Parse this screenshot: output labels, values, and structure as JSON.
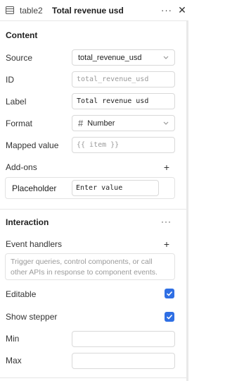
{
  "header": {
    "component_name": "table2",
    "column_title": "Total revenue usd",
    "more_icon": "more-horizontal-icon",
    "close_icon": "close-icon",
    "table_icon": "table-icon"
  },
  "content": {
    "title": "Content",
    "source": {
      "label": "Source",
      "value": "total_revenue_usd"
    },
    "id": {
      "label": "ID",
      "placeholder": "total_revenue_usd"
    },
    "label_field": {
      "label": "Label",
      "value": "Total revenue usd"
    },
    "format": {
      "label": "Format",
      "icon": "hash-icon",
      "value": "Number"
    },
    "mapped_value": {
      "label": "Mapped value",
      "placeholder": "{{ item }}"
    },
    "addons": {
      "label": "Add-ons",
      "items": [
        {
          "label": "Placeholder",
          "value": "Enter value"
        }
      ]
    }
  },
  "interaction": {
    "title": "Interaction",
    "event_handlers": {
      "label": "Event handlers",
      "helper": "Trigger queries, control components, or call other APIs in response to component events."
    },
    "editable": {
      "label": "Editable",
      "checked": true
    },
    "show_stepper": {
      "label": "Show stepper",
      "checked": true
    },
    "min": {
      "label": "Min",
      "value": ""
    },
    "max": {
      "label": "Max",
      "value": ""
    }
  },
  "colors": {
    "accent": "#2f6fe4",
    "border": "#d9d9d9",
    "muted": "#9a9a9a"
  }
}
